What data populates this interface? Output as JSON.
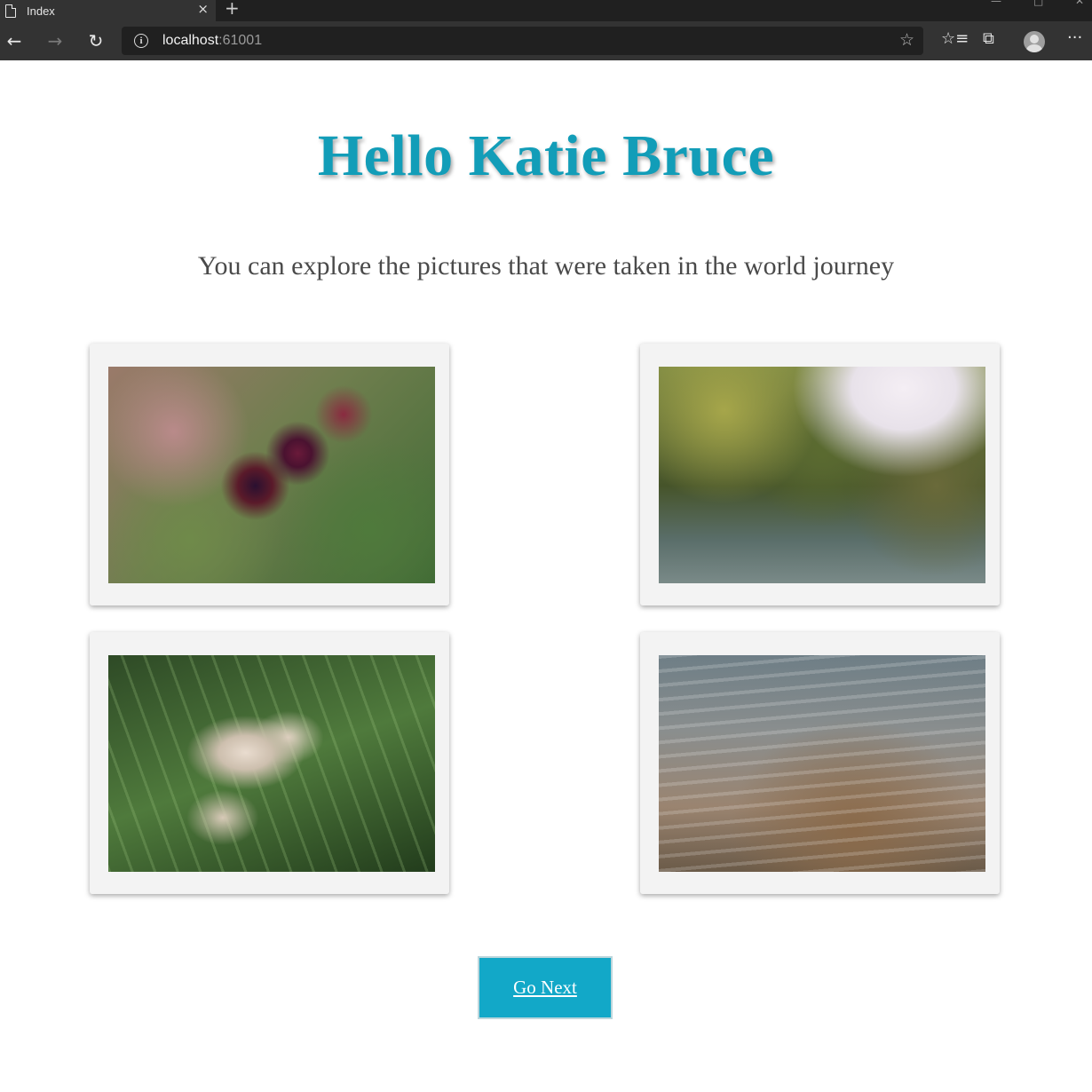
{
  "browser": {
    "tab_title": "Index",
    "close_glyph": "×",
    "newtab_glyph": "+",
    "back_glyph": "←",
    "forward_glyph": "→",
    "reload_glyph": "↻",
    "info_glyph": "i",
    "url_host": "localhost",
    "url_port": ":61001",
    "favorite_glyph": "☆",
    "favorites_glyph": "☆≡",
    "collections_glyph": "⧉",
    "more_glyph": "···"
  },
  "page": {
    "title": "Hello Katie Bruce",
    "subtitle": "You can explore the pictures that were taken in the world journey",
    "photos": [
      {
        "subject": "blackberries"
      },
      {
        "subject": "trees"
      },
      {
        "subject": "wildflowers"
      },
      {
        "subject": "water"
      }
    ],
    "next_button": "Go Next"
  },
  "colors": {
    "title": "#129db8",
    "button": "#12a8c8",
    "card": "#f3f3f3",
    "chrome": "#333333"
  }
}
